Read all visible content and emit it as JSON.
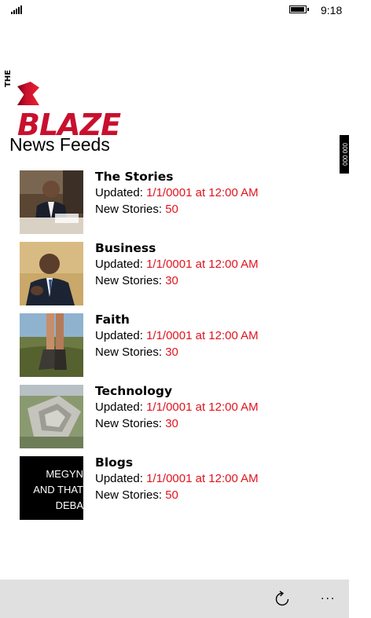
{
  "status_bar": {
    "time": "9:18",
    "signal_icon": "signal-bars-icon",
    "battery_icon": "battery-icon"
  },
  "logo": {
    "text_the": "THE",
    "text_blaze": "BLAZE"
  },
  "page_title": "News Feeds",
  "scroll_indicator": "000  000",
  "feeds": [
    {
      "title": "The Stories",
      "updated_label": "Updated:",
      "updated_value": "1/1/0001 at 12:00 AM",
      "new_label": "New Stories:",
      "new_value": "50",
      "thumb": "obama-desk"
    },
    {
      "title": "Business",
      "updated_label": "Updated:",
      "updated_value": "1/1/0001 at 12:00 AM",
      "new_label": "New Stories:",
      "new_value": "30",
      "thumb": "obama-speaking"
    },
    {
      "title": "Faith",
      "updated_label": "Updated:",
      "updated_value": "1/1/0001 at 12:00 AM",
      "new_label": "New Stories:",
      "new_value": "30",
      "thumb": "hiker-boots"
    },
    {
      "title": "Technology",
      "updated_label": "Updated:",
      "updated_value": "1/1/0001 at 12:00 AM",
      "new_label": "New Stories:",
      "new_value": "30",
      "thumb": "pentagon"
    },
    {
      "title": "Blogs",
      "updated_label": "Updated:",
      "updated_value": "1/1/0001 at 12:00 AM",
      "new_label": "New Stories:",
      "new_value": "50",
      "thumb": "blog-text",
      "thumb_lines": [
        "MEGYN",
        "AND THAT",
        "DEBA"
      ]
    }
  ],
  "app_bar": {
    "refresh_icon": "refresh-icon",
    "more_label": "..."
  },
  "colors": {
    "accent": "#e0141e",
    "app_bar_bg": "#e0e0e0"
  }
}
